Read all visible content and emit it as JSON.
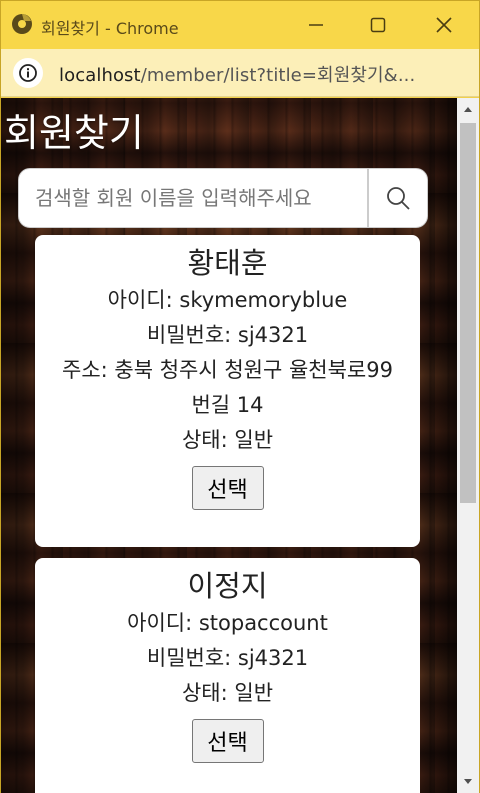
{
  "window": {
    "title": "회원찾기 - Chrome",
    "url_host": "localhost",
    "url_path": "/member/list?title=회원찾기&..."
  },
  "page": {
    "title": "회원찾기",
    "search": {
      "placeholder": "검색할 회원 이름을 입력해주세요",
      "value": ""
    }
  },
  "members": [
    {
      "name": "황태훈",
      "id_line": "아이디: skymemoryblue",
      "pw_line": "비밀번호: sj4321",
      "addr_line": "주소: 충북 청주시 청원구 율천북로99번길 14",
      "status_line": "상태: 일반",
      "select_label": "선택"
    },
    {
      "name": "이정지",
      "id_line": "아이디: stopaccount",
      "pw_line": "비밀번호: sj4321",
      "status_line": "상태: 일반",
      "select_label": "선택"
    }
  ],
  "colors": {
    "titlebar": "#f8d749",
    "addressbar": "#fcefb8",
    "card": "#ffffff"
  },
  "icons": [
    "chrome-logo-icon",
    "minimize-icon",
    "maximize-icon",
    "close-icon",
    "info-icon",
    "search-icon"
  ]
}
